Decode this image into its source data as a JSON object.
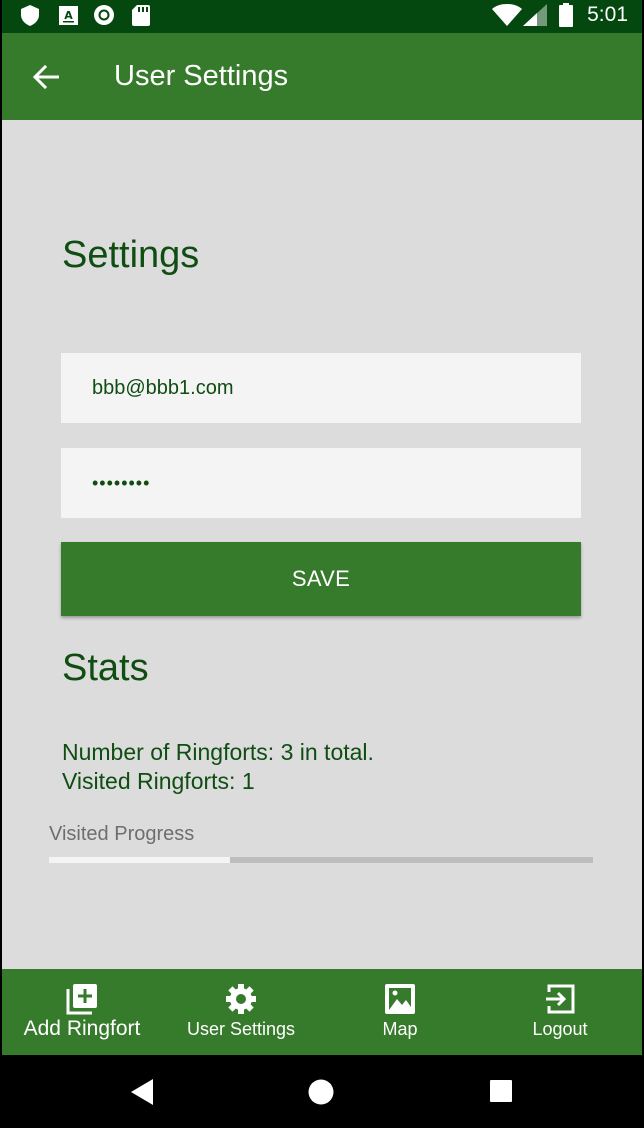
{
  "status_bar": {
    "time": "5:01",
    "icons": [
      "shield-icon",
      "font-a-icon",
      "record-icon",
      "sd-card-icon",
      "wifi-icon",
      "signal-icon",
      "battery-icon"
    ]
  },
  "app_bar": {
    "title": "User Settings",
    "back_icon": "arrow-back-icon"
  },
  "settings": {
    "heading": "Settings",
    "email_value": "bbb@bbb1.com",
    "password_value": "••••••••",
    "save_label": "SAVE"
  },
  "stats": {
    "heading": "Stats",
    "count_line": "Number of Ringforts: 3 in total.",
    "visited_line": "Visited Ringforts: 1",
    "progress_label": "Visited Progress",
    "progress_fraction": 0.333
  },
  "bottom_nav": {
    "items": [
      {
        "label": "Add Ringfort",
        "icon": "add-library-icon"
      },
      {
        "label": "User Settings",
        "icon": "gear-icon"
      },
      {
        "label": "Map",
        "icon": "image-icon"
      },
      {
        "label": "Logout",
        "icon": "exit-icon"
      }
    ]
  },
  "system_nav": {
    "icons": [
      "back-triangle-icon",
      "home-circle-icon",
      "recents-square-icon"
    ]
  },
  "colors": {
    "status_bar": "#05480f",
    "primary": "#367a2b",
    "text_dark_green": "#0f4d12",
    "background": "#dcdcdc"
  }
}
